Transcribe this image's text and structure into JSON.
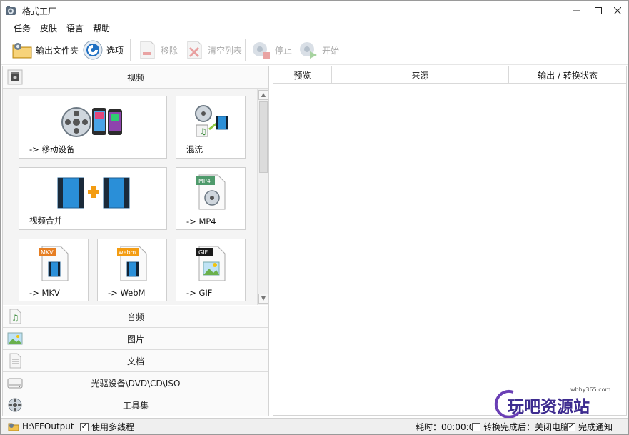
{
  "window": {
    "title": "格式工厂"
  },
  "menu": [
    "任务",
    "皮肤",
    "语言",
    "帮助"
  ],
  "toolbar": {
    "output_folder": "输出文件夹",
    "options": "选项",
    "remove": "移除",
    "clear_list": "清空列表",
    "stop": "停止",
    "start": "开始"
  },
  "categories": {
    "video": "视频",
    "audio": "音频",
    "picture": "图片",
    "document": "文档",
    "rom": "光驱设备\\DVD\\CD\\ISO",
    "tools": "工具集"
  },
  "video_tiles": [
    {
      "label": "-> 移动设备",
      "icon": "mobile-device-icon"
    },
    {
      "label": "混流",
      "icon": "mux-icon"
    },
    {
      "label": "视频合并",
      "icon": "video-join-icon"
    },
    {
      "label": "-> MP4",
      "icon": "mp4-file-icon",
      "badge": "MP4"
    },
    {
      "label": "-> MKV",
      "icon": "mkv-file-icon",
      "badge": "MKV"
    },
    {
      "label": "-> WebM",
      "icon": "webm-file-icon",
      "badge": "webm"
    },
    {
      "label": "-> GIF",
      "icon": "gif-file-icon",
      "badge": "GIF"
    }
  ],
  "table": {
    "columns": [
      "预览",
      "来源",
      "输出 / 转换状态"
    ]
  },
  "watermark": {
    "site": "wbhy365.com",
    "name": "玩吧资源站"
  },
  "status": {
    "output_path": "H:\\FFOutput",
    "multithread_label": "使用多线程",
    "multithread_checked": true,
    "elapsed_label": "耗时：00:00:00",
    "shutdown_label": "转换完成后：关闭电脑",
    "shutdown_checked": false,
    "notify_label": "完成通知",
    "notify_checked": true
  },
  "colors": {
    "accent_orange": "#f39c12",
    "film_blue": "#2a8fd8",
    "disabled_text": "#a9a9a9"
  }
}
